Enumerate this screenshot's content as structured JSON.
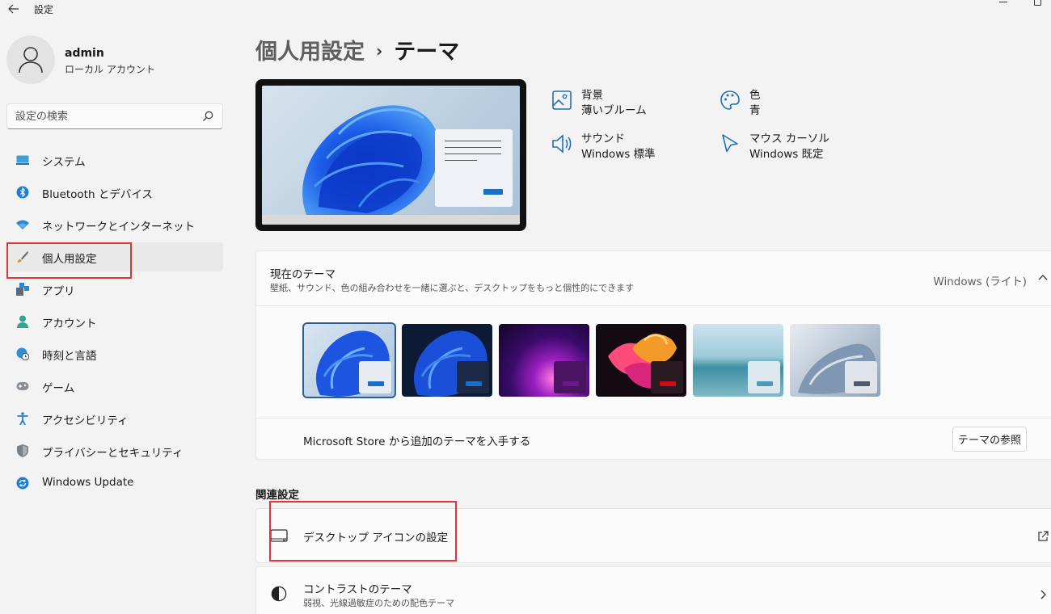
{
  "window": {
    "title": "設定"
  },
  "user": {
    "name": "admin",
    "account_type": "ローカル アカウント"
  },
  "search": {
    "placeholder": "設定の検索"
  },
  "sidebar": {
    "items": [
      {
        "label": "システム",
        "icon": "system-icon"
      },
      {
        "label": "Bluetooth とデバイス",
        "icon": "bluetooth-icon"
      },
      {
        "label": "ネットワークとインターネット",
        "icon": "wifi-icon"
      },
      {
        "label": "個人用設定",
        "icon": "brush-icon",
        "selected": true
      },
      {
        "label": "アプリ",
        "icon": "apps-icon"
      },
      {
        "label": "アカウント",
        "icon": "person-icon"
      },
      {
        "label": "時刻と言語",
        "icon": "globe-clock-icon"
      },
      {
        "label": "ゲーム",
        "icon": "gamepad-icon"
      },
      {
        "label": "アクセシビリティ",
        "icon": "accessibility-icon"
      },
      {
        "label": "プライバシーとセキュリティ",
        "icon": "shield-icon"
      },
      {
        "label": "Windows Update",
        "icon": "update-icon"
      }
    ]
  },
  "breadcrumb": {
    "parent": "個人用設定",
    "separator": "›",
    "current": "テーマ"
  },
  "quick_settings": {
    "background": {
      "title": "背景",
      "value": "薄いブルーム"
    },
    "color": {
      "title": "色",
      "value": "青"
    },
    "sound": {
      "title": "サウンド",
      "value": "Windows 標準"
    },
    "cursor": {
      "title": "マウス カーソル",
      "value": "Windows 既定"
    }
  },
  "current_theme": {
    "title": "現在のテーマ",
    "description": "壁紙、サウンド、色の組み合わせを一緒に選ぶと、デスクトップをもっと個性的にできます",
    "value": "Windows (ライト)",
    "themes": [
      {
        "name": "windows-light",
        "selected": true,
        "accent": "#1a6fc4"
      },
      {
        "name": "windows-dark",
        "selected": false,
        "accent": "#1a6fc4"
      },
      {
        "name": "glow",
        "selected": false,
        "accent": "#6a1a8a"
      },
      {
        "name": "captured-motion",
        "selected": false,
        "accent": "#d00a1a"
      },
      {
        "name": "sunrise",
        "selected": false,
        "accent": "#4f9bb5"
      },
      {
        "name": "flow",
        "selected": false,
        "accent": "#4e5a6a"
      }
    ],
    "store_text": "Microsoft Store から追加のテーマを入手する",
    "browse_label": "テーマの参照"
  },
  "related": {
    "title": "関連設定",
    "desktop_icons": {
      "label": "デスクトップ アイコンの設定"
    },
    "contrast": {
      "label": "コントラストのテーマ",
      "sub": "弱視、光線過敏症のための配色テーマ"
    }
  },
  "colors": {
    "highlight": "#d9363e",
    "accent": "#1a6fc4",
    "selection_outline": "#2c5c9a"
  }
}
